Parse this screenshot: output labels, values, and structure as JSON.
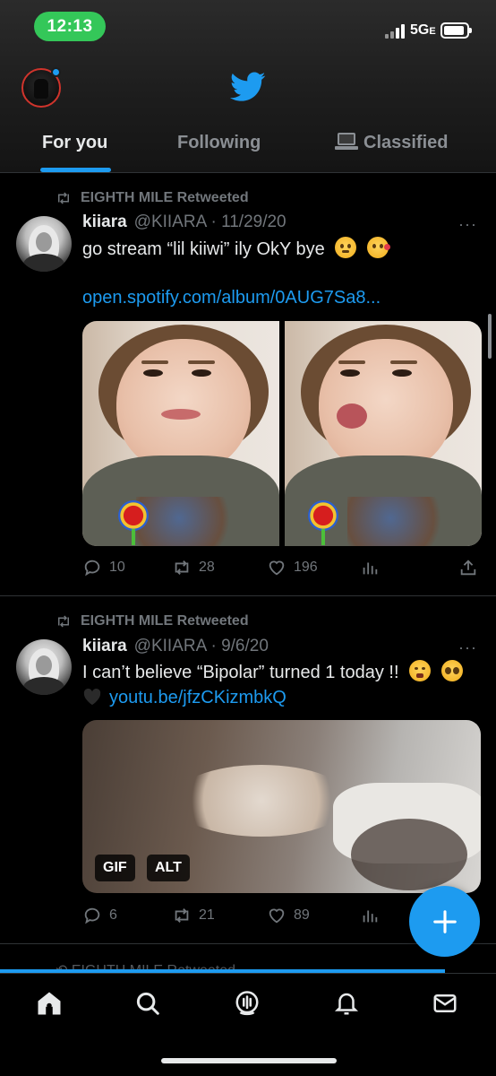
{
  "status_bar": {
    "time": "12:13",
    "network": "5G",
    "network_suffix": "E"
  },
  "tabs": [
    {
      "label": "For you",
      "active": true
    },
    {
      "label": "Following",
      "active": false
    },
    {
      "label": "Classified",
      "active": false,
      "icon": "laptop-icon"
    }
  ],
  "tweets": [
    {
      "retweeted_by": "EIGHTH MILE",
      "retweeted_label": "Retweeted",
      "display_name": "kiiara",
      "handle_date": "@KIIARA · 11/29/20",
      "text": "go stream “lil kiiwi” ily OkY bye",
      "emojis": [
        "hugging-face-emoji",
        "face-blowing-kiss-emoji"
      ],
      "link": "open.spotify.com/album/0AUG7Sa8...",
      "replies": "10",
      "retweets": "28",
      "likes": "196"
    },
    {
      "retweeted_by": "EIGHTH MILE",
      "retweeted_label": "Retweeted",
      "display_name": "kiiara",
      "handle_date": "@KIIARA · 9/6/20",
      "text": "I can’t believe “Bipolar” turned 1 today !!",
      "emojis": [
        "weary-face-emoji",
        "pleading-face-emoji",
        "black-heart-emoji"
      ],
      "link": "youtu.be/jfzCKizmbkQ",
      "badges": [
        "GIF",
        "ALT"
      ],
      "replies": "6",
      "retweets": "21",
      "likes": "89"
    }
  ],
  "peek": {
    "retweeted_by": "EIGHTH MILE",
    "retweeted_label": "Retweeted"
  },
  "more_label": "···",
  "colors": {
    "accent": "#1d9bf0",
    "background": "#000000",
    "muted": "#71767b",
    "time_pill": "#34c759"
  },
  "bottom_nav": [
    "home-icon",
    "search-icon",
    "spaces-icon",
    "notifications-icon",
    "messages-icon"
  ]
}
